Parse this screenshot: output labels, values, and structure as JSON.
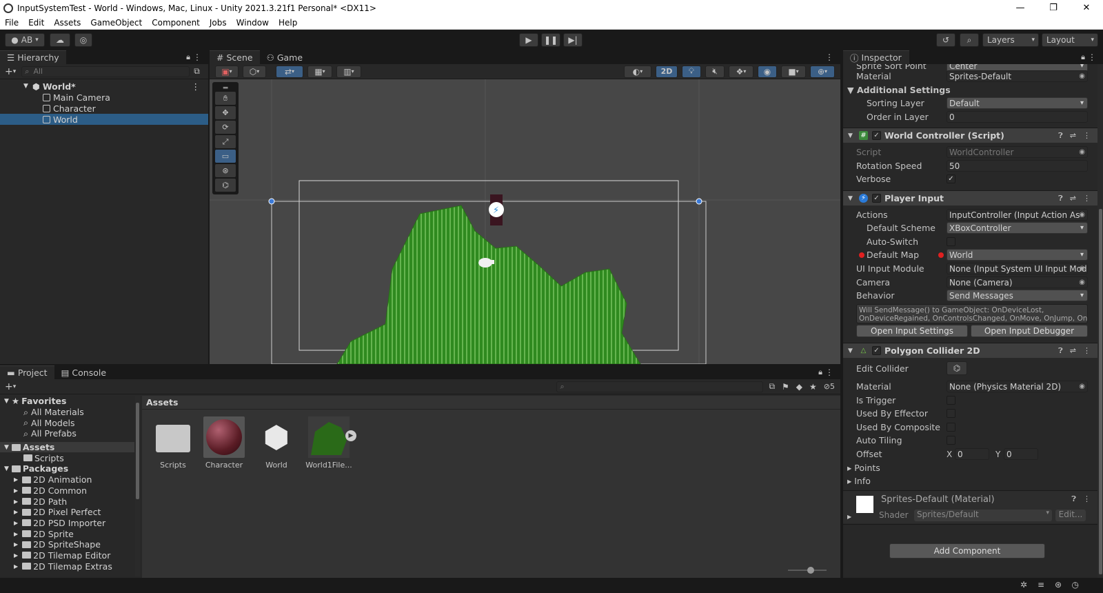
{
  "window": {
    "title": "InputSystemTest - World - Windows, Mac, Linux - Unity 2021.3.21f1 Personal* <DX11>",
    "controls": [
      "—",
      "❐",
      "✕"
    ]
  },
  "menu": [
    "File",
    "Edit",
    "Assets",
    "GameObject",
    "Component",
    "Jobs",
    "Window",
    "Help"
  ],
  "toolbar": {
    "account": "AB",
    "layers": "Layers",
    "layout": "Layout"
  },
  "hierarchy": {
    "tab": "Hierarchy",
    "search_placeholder": "All",
    "scene": "World*",
    "items": [
      "Main Camera",
      "Character",
      "World"
    ]
  },
  "scene": {
    "tabs": [
      "Scene",
      "Game"
    ],
    "mode_2d": "2D"
  },
  "project": {
    "tabs": [
      "Project",
      "Console"
    ],
    "hidden_count": "5",
    "favorites_label": "Favorites",
    "favorites": [
      "All Materials",
      "All Models",
      "All Prefabs"
    ],
    "assets_label": "Assets",
    "assets_children": [
      "Scripts"
    ],
    "packages_label": "Packages",
    "packages": [
      "2D Animation",
      "2D Common",
      "2D Path",
      "2D Pixel Perfect",
      "2D PSD Importer",
      "2D Sprite",
      "2D SpriteShape",
      "2D Tilemap Editor",
      "2D Tilemap Extras"
    ],
    "breadcrumb": "Assets",
    "grid": [
      "Scripts",
      "Character",
      "World",
      "World1File..."
    ]
  },
  "inspector": {
    "tab": "Inspector",
    "cutoff_label": "Sprite Sort Point",
    "cutoff_value": "Center",
    "material_label": "Material",
    "material_value": "Sprites-Default",
    "additional_settings": "Additional Settings",
    "sorting_layer_label": "Sorting Layer",
    "sorting_layer_value": "Default",
    "order_label": "Order in Layer",
    "order_value": "0",
    "world_controller": {
      "title": "World Controller (Script)",
      "script_label": "Script",
      "script_value": "WorldController",
      "rotation_label": "Rotation Speed",
      "rotation_value": "50",
      "verbose_label": "Verbose"
    },
    "player_input": {
      "title": "Player Input",
      "actions_label": "Actions",
      "actions_value": "InputController (Input Action As",
      "default_scheme_label": "Default Scheme",
      "default_scheme_value": "XBoxController",
      "auto_switch_label": "Auto-Switch",
      "default_map_label": "Default Map",
      "default_map_value": "World",
      "ui_module_label": "UI Input Module",
      "ui_module_value": "None (Input System UI Input Modu",
      "camera_label": "Camera",
      "camera_value": "None (Camera)",
      "behavior_label": "Behavior",
      "behavior_value": "Send Messages",
      "info_line1": "Will SendMessage() to GameObject: OnDeviceLost,",
      "info_line2": "OnDeviceRegained, OnControlsChanged, OnMove, OnJump, OnFire",
      "open_settings": "Open Input Settings",
      "open_debugger": "Open Input Debugger"
    },
    "polygon": {
      "title": "Polygon Collider 2D",
      "edit_collider_label": "Edit Collider",
      "material_label": "Material",
      "material_value": "None (Physics Material 2D)",
      "is_trigger_label": "Is Trigger",
      "used_by_effector_label": "Used By Effector",
      "used_by_composite_label": "Used By Composite",
      "auto_tiling_label": "Auto Tiling",
      "offset_label": "Offset",
      "offset_x_label": "X",
      "offset_x": "0",
      "offset_y_label": "Y",
      "offset_y": "0",
      "points_label": "Points",
      "info_label": "Info"
    },
    "material_block": {
      "name": "Sprites-Default (Material)",
      "shader_label": "Shader",
      "shader_value": "Sprites/Default",
      "edit_label": "Edit..."
    },
    "add_component": "Add Component"
  },
  "colors": {
    "selection": "#2c5d87",
    "terrain": "#3fae2a",
    "panel": "#282828",
    "accent_blue": "#3b5f86"
  }
}
